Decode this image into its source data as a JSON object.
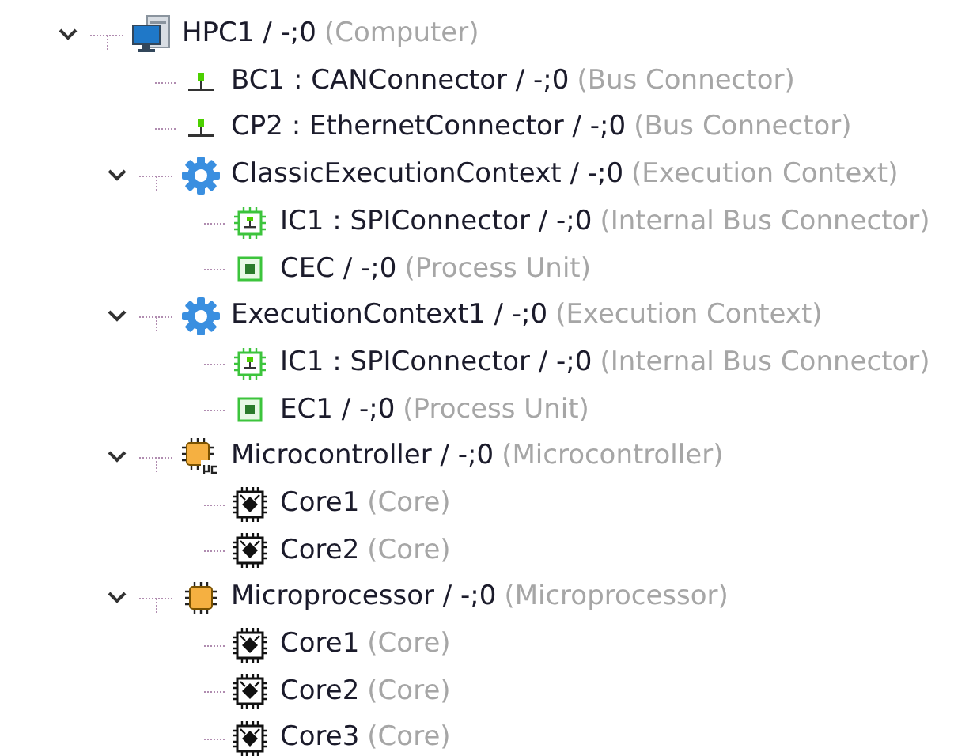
{
  "tree": [
    {
      "label": "HPC1 / -;0",
      "type": "(Computer)",
      "kind": "computer",
      "expanded": true,
      "children": [
        {
          "label": "BC1 : CANConnector / -;0",
          "type": "(Bus Connector)",
          "kind": "bus-connector"
        },
        {
          "label": "CP2 : EthernetConnector / -;0",
          "type": "(Bus Connector)",
          "kind": "bus-connector"
        },
        {
          "label": "ClassicExecutionContext / -;0",
          "type": "(Execution Context)",
          "kind": "execution-context",
          "expanded": true,
          "children": [
            {
              "label": "IC1 : SPIConnector / -;0",
              "type": "(Internal Bus Connector)",
              "kind": "internal-bus-connector"
            },
            {
              "label": "CEC / -;0",
              "type": "(Process Unit)",
              "kind": "process-unit"
            }
          ]
        },
        {
          "label": "ExecutionContext1 / -;0",
          "type": "(Execution Context)",
          "kind": "execution-context",
          "expanded": true,
          "children": [
            {
              "label": "IC1 : SPIConnector / -;0",
              "type": "(Internal Bus Connector)",
              "kind": "internal-bus-connector"
            },
            {
              "label": "EC1 / -;0",
              "type": "(Process Unit)",
              "kind": "process-unit"
            }
          ]
        },
        {
          "label": "Microcontroller / -;0",
          "type": "(Microcontroller)",
          "kind": "microcontroller",
          "expanded": true,
          "children": [
            {
              "label": "Core1",
              "type": "(Core)",
              "kind": "core"
            },
            {
              "label": "Core2",
              "type": "(Core)",
              "kind": "core"
            }
          ]
        },
        {
          "label": "Microprocessor / -;0",
          "type": "(Microprocessor)",
          "kind": "microprocessor",
          "expanded": true,
          "children": [
            {
              "label": "Core1",
              "type": "(Core)",
              "kind": "core"
            },
            {
              "label": "Core2",
              "type": "(Core)",
              "kind": "core"
            },
            {
              "label": "Core3",
              "type": "(Core)",
              "kind": "core"
            }
          ]
        }
      ]
    }
  ]
}
